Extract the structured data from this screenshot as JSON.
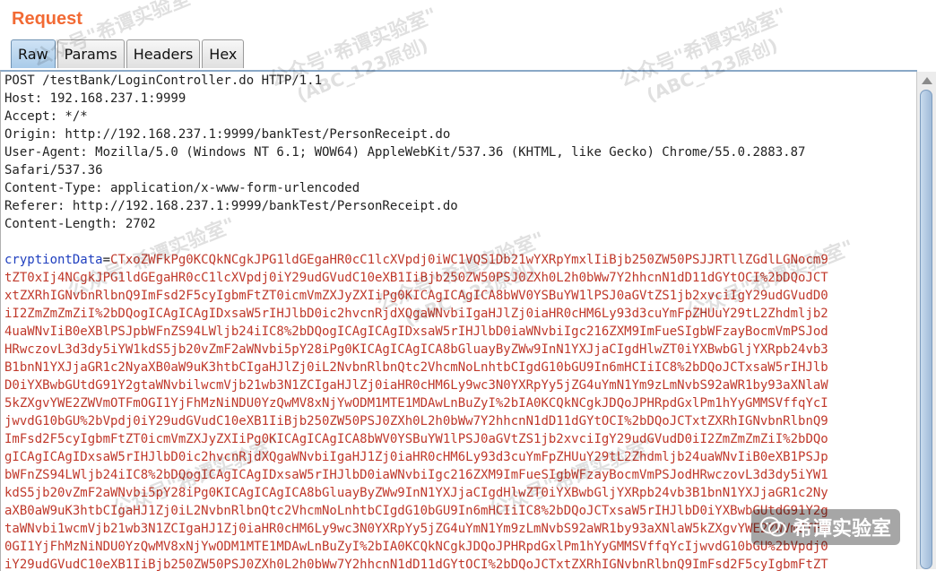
{
  "header": {
    "title": "Request"
  },
  "tabs": [
    {
      "label": "Raw",
      "active": true
    },
    {
      "label": "Params"
    },
    {
      "label": "Headers"
    },
    {
      "label": "Hex"
    }
  ],
  "request_lines": [
    "POST /testBank/LoginController.do HTTP/1.1",
    "Host: 192.168.237.1:9999",
    "Accept: */*",
    "Origin: http://192.168.237.1:9999/bankTest/PersonReceipt.do",
    "User-Agent: Mozilla/5.0 (Windows NT 6.1; WOW64) AppleWebKit/537.36 (KHTML, like Gecko) Chrome/55.0.2883.87",
    "Safari/537.36",
    "Content-Type: application/x-www-form-urlencoded",
    "Referer: http://192.168.237.1:9999/bankTest/PersonReceipt.do",
    "Content-Length: 2702"
  ],
  "body": {
    "param_name": "cryptiontData",
    "first_line_value": "CTxoZWFkPg0KCQkNCgkJPG1ldGEgaHR0cC1lcXVpdj0iWC1VQS1Db21wYXRpYmxlIiBjb250ZW50PSJJRTllZGdlLGNocm9",
    "lines": [
      "tZT0xIj4NCgkJPG1ldGEgaHR0cC1lcXVpdj0iY29udGVudC10eXB1IiBjb250ZW50PSJ0ZXh0L2h0bWw7Y2hhcnN1dD11dGYtOCI%2bDQoJCT",
      "xtZXRhIGNvbnRlbnQ9ImFsd2F5cyIgbmFtZT0icmVmZXJyZXIiPg0KICAgICAgICA8bWV0YSBuYW1lPSJ0aGVtZS1jb2xvciIgY29udGVudD0",
      "iI2ZmZmZmZiI%2bDQogICAgICAgIDxsaW5rIHJlbD0ic2hvcnRjdXQgaWNvbiIgaHJlZj0iaHR0cHM6Ly93d3cuYmFpZHUuY29tL2Zhdmljb2",
      "4uaWNvIiB0eXBlPSJpbWFnZS94LWljb24iIC8%2bDQogICAgICAgIDxsaW5rIHJlbD0iaWNvbiIgc216ZXM9ImFueSIgbWFzayBocmVmPSJod",
      "HRwczovL3d3dy5iYW1kdS5jb20vZmF2aWNvbi5pY28iPg0KICAgICAgICA8bGluayByZWw9InN1YXJjaCIgdHlwZT0iYXBwbGljYXRpb24vb3",
      "B1bnN1YXJjaGR1c2NyaXB0aW9uK3htbCIgaHJlZj0iL2NvbnRlbnQtc2VhcmNoLnhtbCIgdG10bGU9In6mHCIiIC8%2bDQoJCTxsaW5rIHJlb",
      "D0iYXBwbGUtdG91Y2gtaWNvbilwcmVjb21wb3N1ZCIgaHJlZj0iaHR0cHM6Ly9wc3N0YXRpYy5jZG4uYmN1Ym9zLmNvbS92aWR1by93aXNlaW",
      "5kZXgvYWE2ZWVmOTFmOGI1YjFhMzNiNDU0YzQwMV8xNjYwODM1MTE1MDAwLnBuZyI%2bIA0KCQkNCgkJDQoJPHRpdGxlPm1hYyGMMSVffqYcI",
      "jwvdG10bGU%2bVpdj0iY29udGVudC10eXB1IiBjb250ZW50PSJ0ZXh0L2h0bWw7Y2hhcnN1dD11dGYtOCI%2bDQoJCTxtZXRhIGNvbnRlbnQ9",
      "ImFsd2F5cyIgbmFtZT0icmVmZXJyZXIiPg0KICAgICAgICA8bWV0YSBuYW1lPSJ0aGVtZS1jb2xvciIgY29udGVudD0iI2ZmZmZmZiI%2bDQo",
      "gICAgICAgIDxsaW5rIHJlbD0ic2hvcnRjdXQgaWNvbiIgaHJ1Zj0iaHR0cHM6Ly93d3cuYmFpZHUuY29tL2Zhdmljb24uaWNvIiB0eXB1PSJp",
      "bWFnZS94LWljb24iIC8%2bDQogICAgICAgIDxsaW5rIHJlbD0iaWNvbiIgc216ZXM9ImFueSIgbWFzayBocmVmPSJodHRwczovL3d3dy5iYW1",
      "kdS5jb20vZmF2aWNvbi5pY28iPg0KICAgICAgICA8bGluayByZWw9InN1YXJjaCIgdHlwZT0iYXBwbGljYXRpb24vb3B1bnN1YXJjaGR1c2Ny",
      "aXB0aW9uK3htbCIgaHJ1Zj0iL2NvbnRlbnQtc2VhcmNoLnhtbCIgdG10bGU9In6mHCIiIC8%2bDQoJCTxsaW5rIHJlbD0iYXBwbGUtdG91Y2g",
      "taWNvbi1wcmVjb21wb3N1ZCIgaHJ1Zj0iaHR0cHM6Ly9wc3N0YXRpYy5jZG4uYmN1Ym9zLmNvbS92aWR1by93aXNlaW5kZXgvYWE2ZWVmOTFm",
      "0GI1YjFhMzNiNDU0YzQwMV8xNjYwODM1MTE1MDAwLnBuZyI%2bIA0KCQkNCgkJDQoJPHRpdGxlPm1hYyGMMSVffqYcIjwvdG10bGU%2bVpdj0",
      "iY29udGVudC10eXB1IiBjb250ZW50PSJ0ZXh0L2h0bWw7Y2hhcnN1dD11dGYtOCI%2bDQoJCTxtZXRhIGNvbnRlbnQ9ImFsd2F5cyIgbmFtZT"
    ]
  },
  "watermarks": {
    "line1": "公众号\"希谭实验室\"",
    "line2": "(ABC_123原创)"
  },
  "badge": {
    "text": "希谭实验室"
  },
  "icons": {
    "scroll_up": "chevron-up-icon",
    "logo": "wechat-logo-icon"
  },
  "colors": {
    "title": "#f26a34",
    "param_name": "#1f3fbf",
    "body_value": "#c0392b",
    "active_tab": "#a9cbe9"
  }
}
